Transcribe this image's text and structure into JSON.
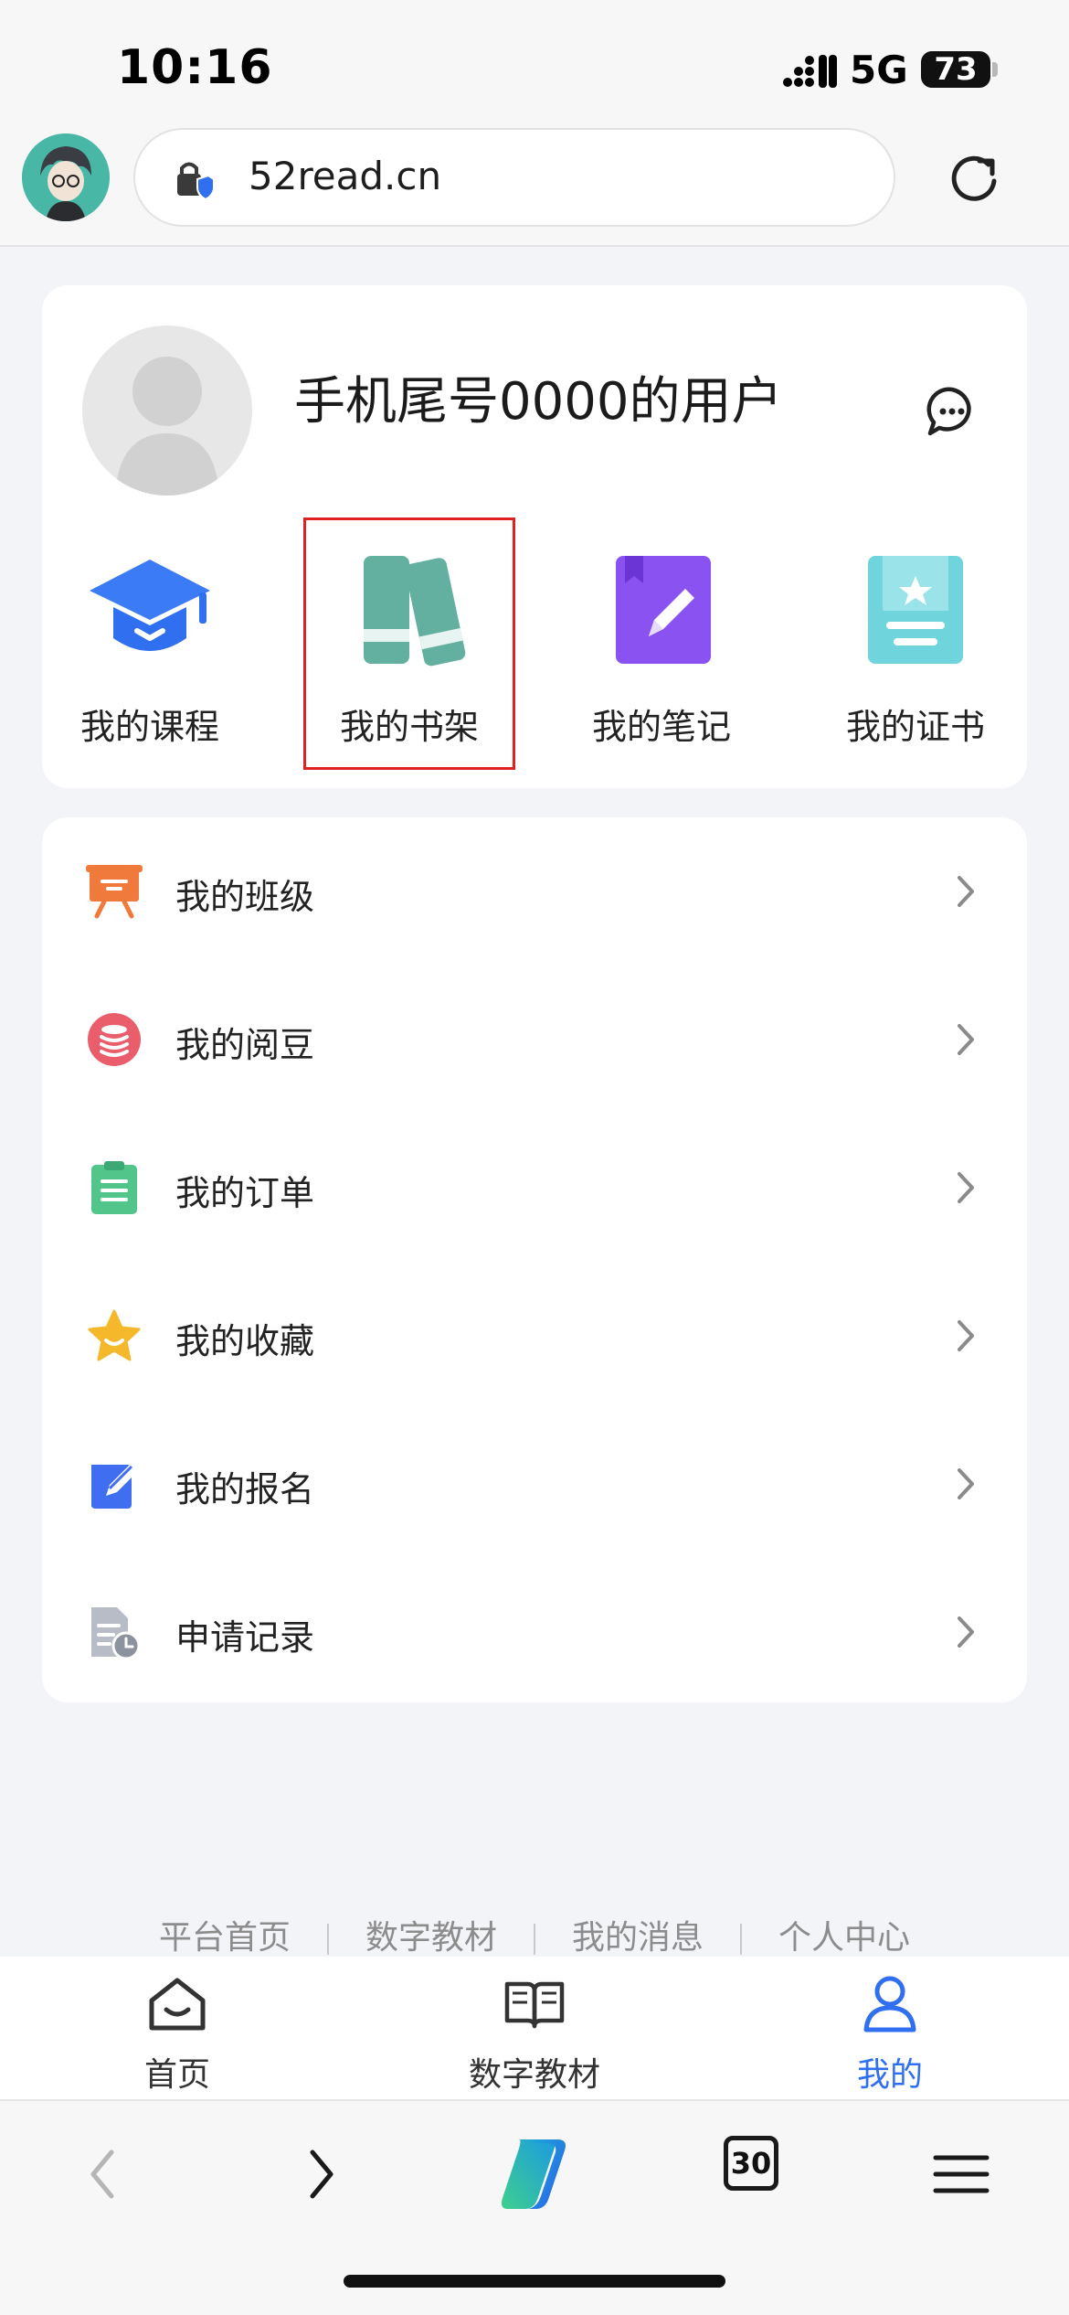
{
  "status_bar": {
    "time": "10:16",
    "network": "5G",
    "battery": "73"
  },
  "browser": {
    "url": "52read.cn"
  },
  "profile": {
    "username": "手机尾号0000的用户"
  },
  "quick_actions": [
    {
      "label": "我的课程",
      "icon": "graduation-cap-icon"
    },
    {
      "label": "我的书架",
      "icon": "bookshelf-icon"
    },
    {
      "label": "我的笔记",
      "icon": "notebook-pen-icon"
    },
    {
      "label": "我的证书",
      "icon": "certificate-icon"
    }
  ],
  "menu": [
    {
      "label": "我的班级",
      "icon": "class-board-icon",
      "color": "#f07a3c"
    },
    {
      "label": "我的阅豆",
      "icon": "coin-stack-icon",
      "color": "#ea5d6b"
    },
    {
      "label": "我的订单",
      "icon": "clipboard-list-icon",
      "color": "#52c58a"
    },
    {
      "label": "我的收藏",
      "icon": "star-icon",
      "color": "#f5b82a"
    },
    {
      "label": "我的报名",
      "icon": "edit-form-icon",
      "color": "#3f6ff0"
    },
    {
      "label": "申请记录",
      "icon": "document-clock-icon",
      "color": "#9aa0ab"
    }
  ],
  "footer_links": [
    "平台首页",
    "数字教材",
    "我的消息",
    "个人中心"
  ],
  "site_nav": [
    {
      "label": "首页",
      "icon": "home-icon"
    },
    {
      "label": "数字教材",
      "icon": "open-book-icon"
    },
    {
      "label": "我的",
      "icon": "person-icon",
      "active": true
    }
  ],
  "browser_toolbar": {
    "tab_count": "30"
  },
  "colors": {
    "accent": "#2f6ff0",
    "highlight_box": "#e0211f",
    "background": "#f3f4f8"
  }
}
